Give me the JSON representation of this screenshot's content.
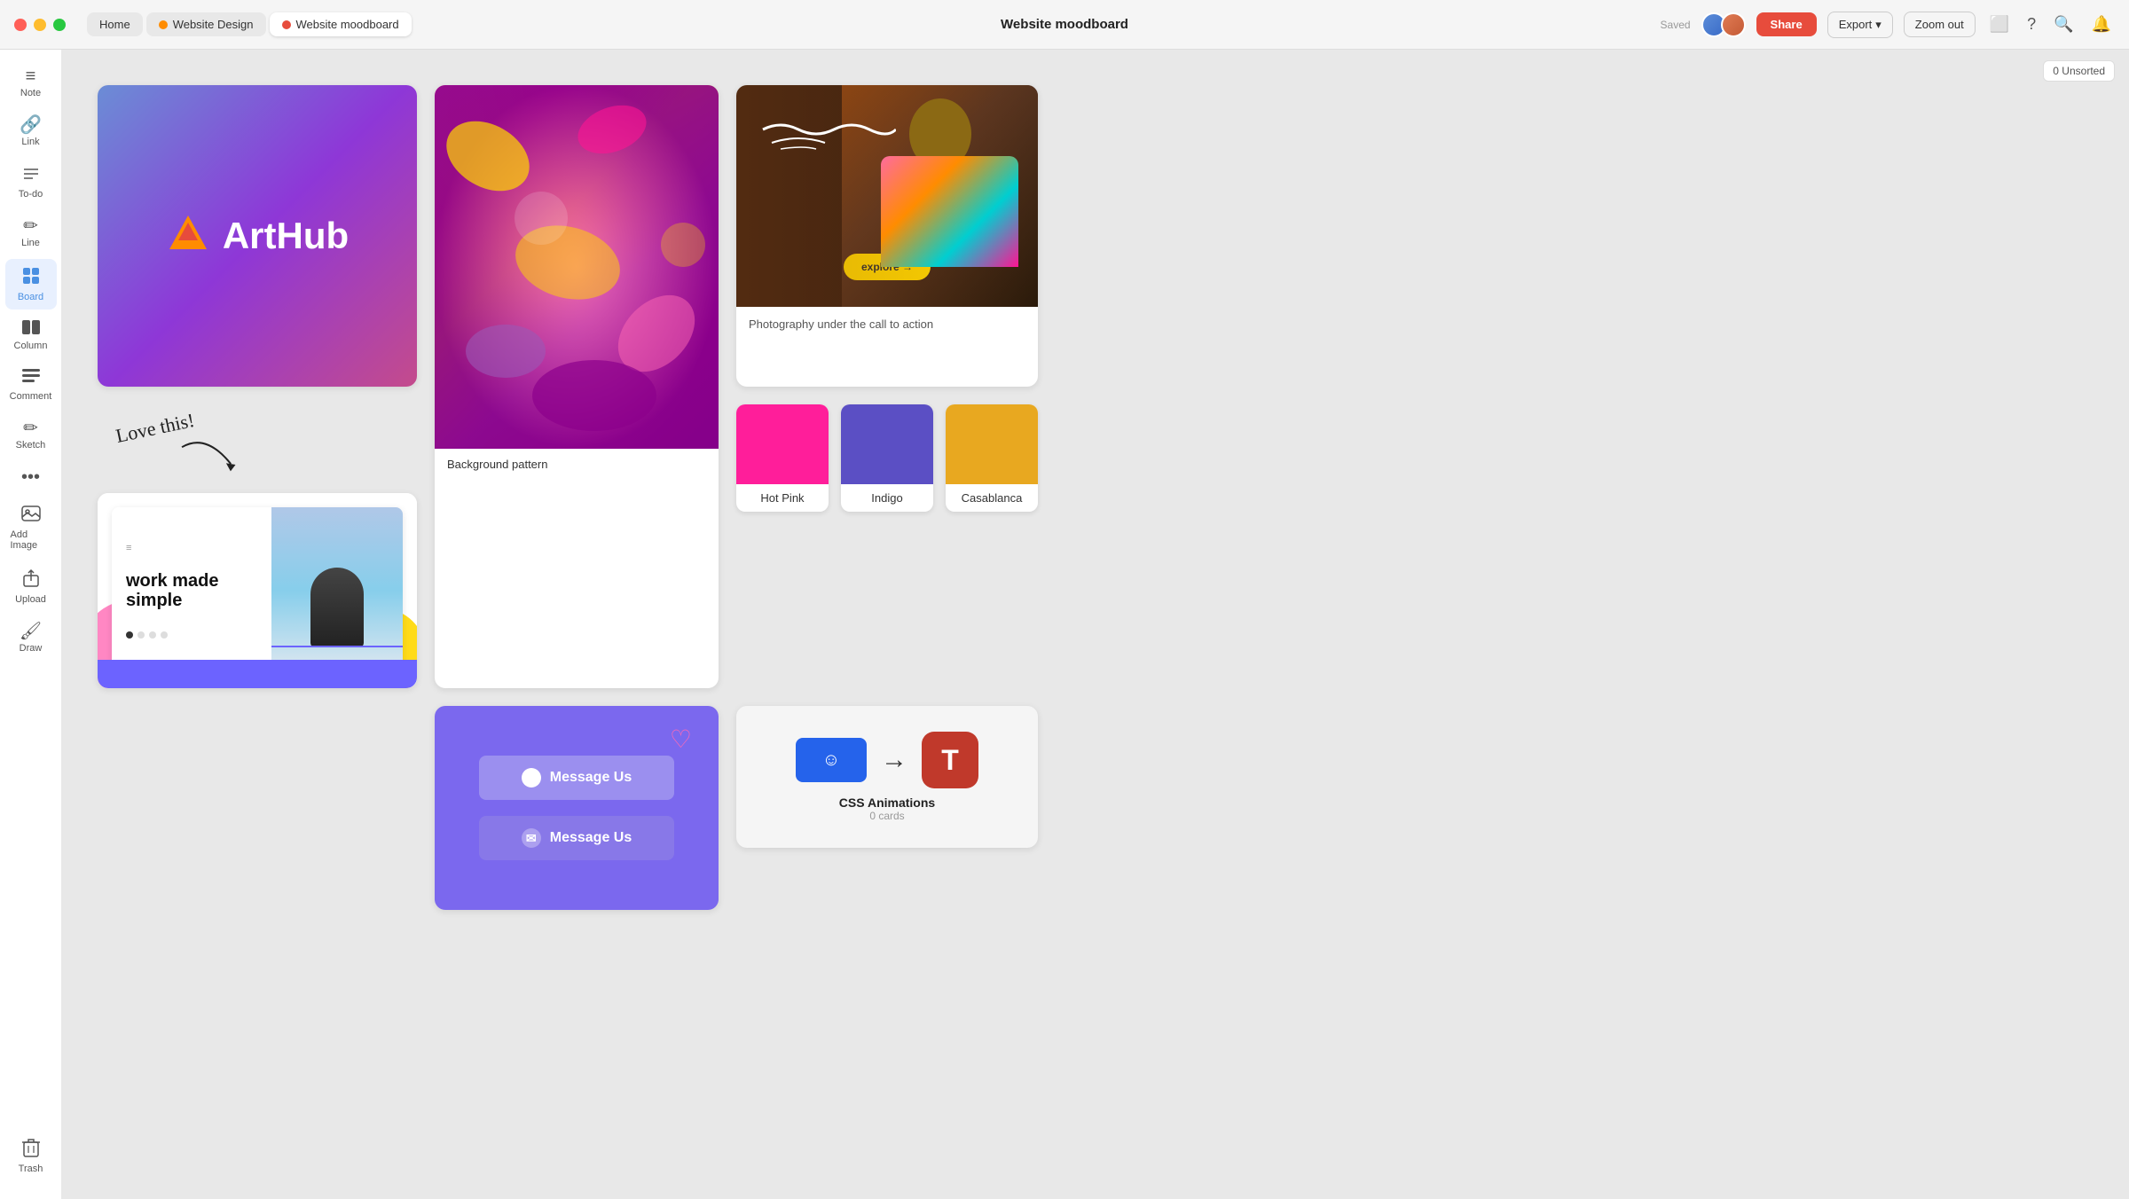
{
  "titlebar": {
    "window_controls": [
      "close",
      "minimize",
      "maximize"
    ],
    "tabs": [
      {
        "id": "home",
        "label": "Home",
        "dot_color": null,
        "active": false
      },
      {
        "id": "website-design",
        "label": "Website Design",
        "dot_color": "#ff8c00",
        "active": false
      },
      {
        "id": "website-moodboard",
        "label": "Website moodboard",
        "dot_color": "#e74c3c",
        "active": true
      }
    ],
    "page_title": "Website moodboard",
    "saved_label": "Saved",
    "share_label": "Share",
    "export_label": "Export",
    "zoom_label": "Zoom out",
    "unsorted_label": "0 Unsorted"
  },
  "sidebar": {
    "items": [
      {
        "id": "note",
        "icon": "≡",
        "label": "Note"
      },
      {
        "id": "link",
        "icon": "🔗",
        "label": "Link"
      },
      {
        "id": "todo",
        "icon": "☰",
        "label": "To-do"
      },
      {
        "id": "line",
        "icon": "╱",
        "label": "Line"
      },
      {
        "id": "board",
        "icon": "⊞",
        "label": "Board",
        "active": true
      },
      {
        "id": "column",
        "icon": "▬",
        "label": "Column"
      },
      {
        "id": "comment",
        "icon": "≡",
        "label": "Comment"
      },
      {
        "id": "sketch",
        "icon": "✏",
        "label": "Sketch"
      },
      {
        "id": "more",
        "icon": "•••",
        "label": ""
      },
      {
        "id": "add-image",
        "icon": "🖼",
        "label": "Add Image"
      },
      {
        "id": "upload",
        "icon": "📄",
        "label": "Upload"
      },
      {
        "id": "draw",
        "icon": "🖌",
        "label": "Draw"
      }
    ],
    "trash_label": "Trash"
  },
  "canvas": {
    "cards": {
      "arthub": {
        "annotation": "Love this!",
        "logo_text": "ArtHub"
      },
      "bg_pattern": {
        "label": "Background pattern"
      },
      "photo": {
        "caption": "Photography under the call to action",
        "cta_text": "explore →"
      },
      "website_mockup": {
        "headline": "work made simple",
        "dots": 4
      },
      "messenger": {
        "btn1": "Message Us",
        "btn2": "Message Us"
      },
      "swatches": [
        {
          "id": "hot-pink",
          "color": "#FF1E9A",
          "label": "Hot Pink"
        },
        {
          "id": "indigo",
          "color": "#5B4FC4",
          "label": "Indigo"
        },
        {
          "id": "casablanca",
          "color": "#E8A820",
          "label": "Casablanca"
        }
      ],
      "css_animations": {
        "title": "CSS Animations",
        "count": "0 cards"
      }
    }
  }
}
